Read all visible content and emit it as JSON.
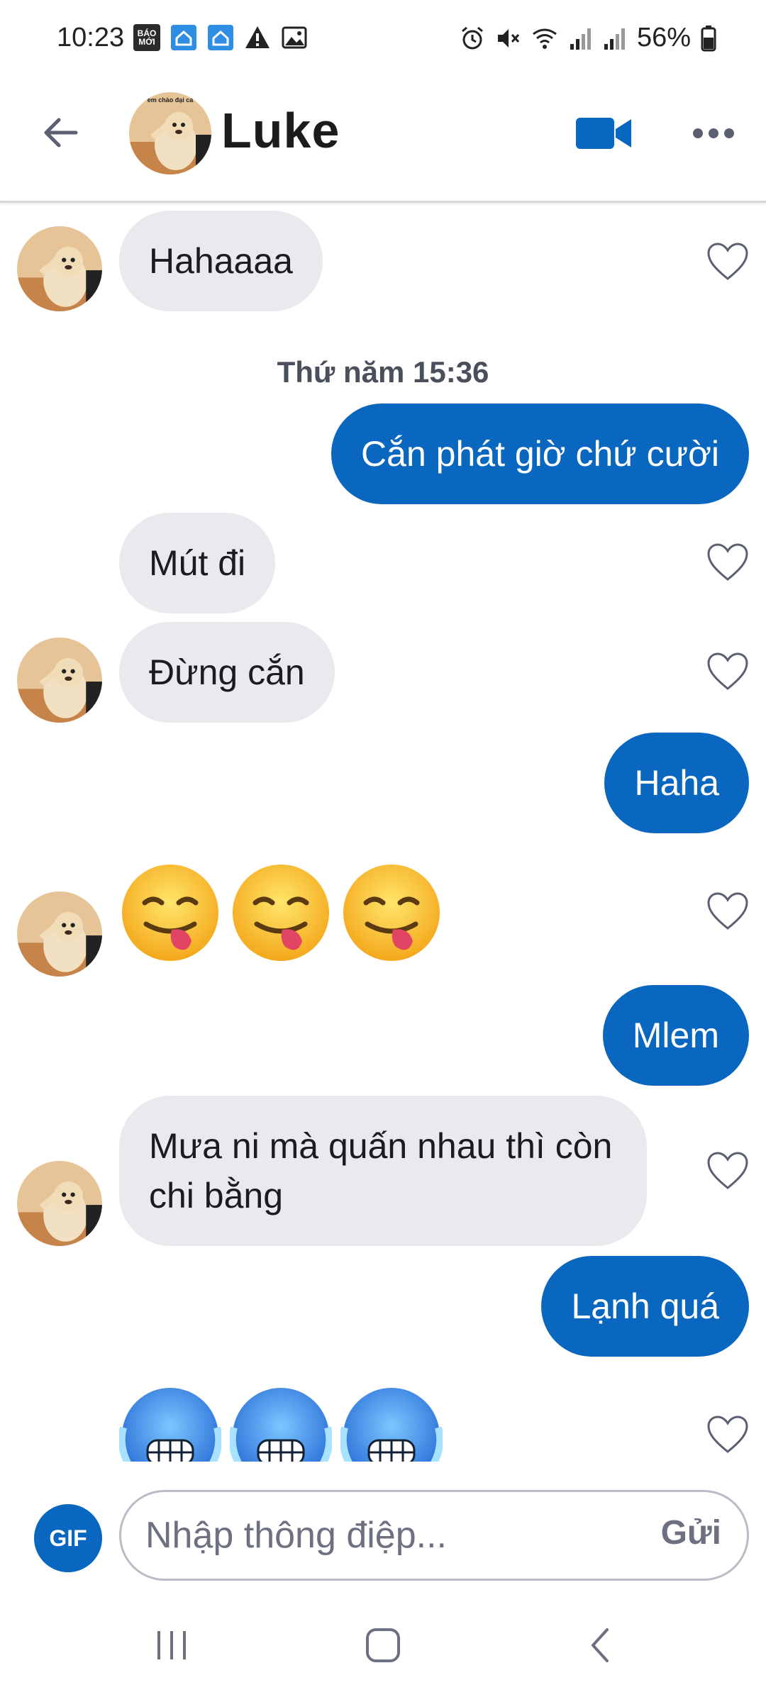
{
  "status_bar": {
    "time": "10:23",
    "battery": "56%",
    "left_icons": [
      "baomoi-icon",
      "home-app-icon",
      "home-app-icon",
      "warning-icon",
      "image-icon"
    ],
    "baomoi_label": "BÁO MỚI",
    "right_icons": [
      "alarm-icon",
      "mute-icon",
      "wifi-icon",
      "signal-icon",
      "signal-icon",
      "battery-icon"
    ]
  },
  "header": {
    "contact_name": "Luke",
    "avatar_caption": "em chào đại ca"
  },
  "messages": {
    "m1": "Hahaaaa",
    "timestamp": "Thứ năm 15:36",
    "m2": "Cắn phát giờ chứ cười",
    "m3": "Mút đi",
    "m4": "Đừng cắn",
    "m5": "Haha",
    "m6_emoji": "😋😋😋",
    "m7": "Mlem",
    "m8": "Mưa ni mà quấn nhau thì còn chi bằng",
    "m9": "Lạnh quá",
    "m10_emoji": "🥶🥶🥶"
  },
  "composer": {
    "gif_label": "GIF",
    "placeholder": "Nhập thông điệp...",
    "send_label": "Gửi"
  },
  "colors": {
    "accent": "#0a67c0",
    "incoming_bubble": "#e9e9ee",
    "outgoing_bubble": "#0a67c0"
  }
}
